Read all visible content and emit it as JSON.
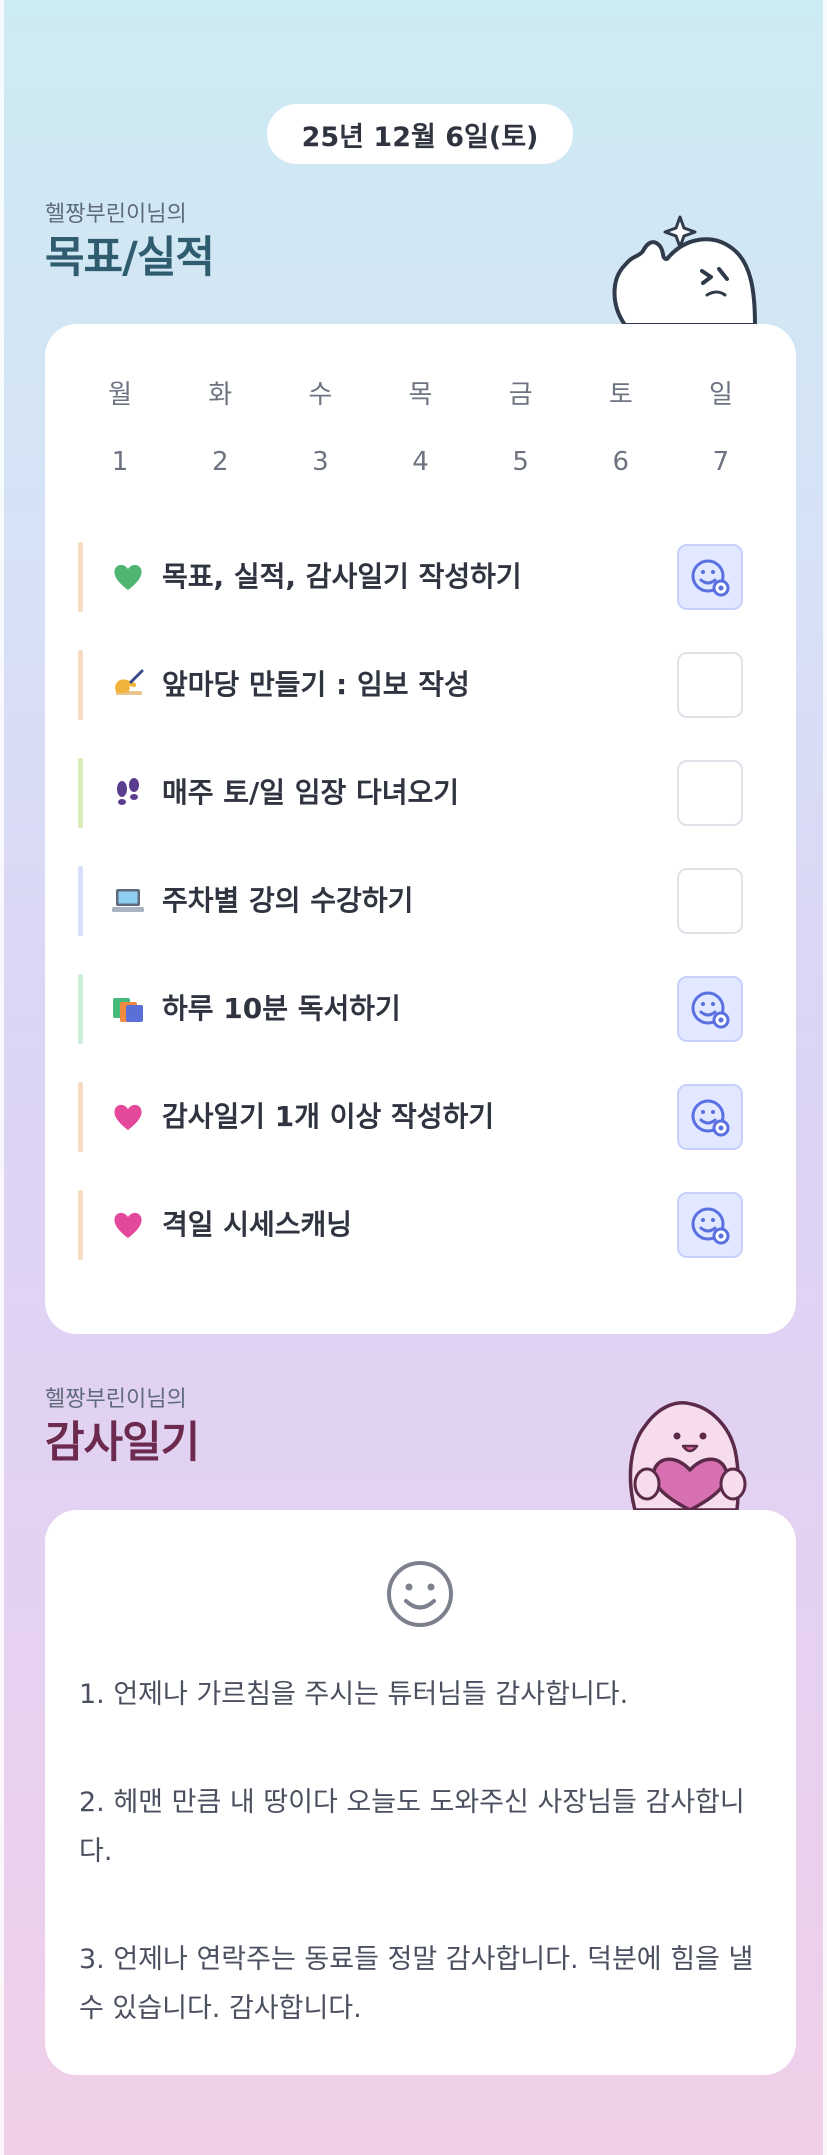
{
  "date_label": "25년 12월 6일(토)",
  "goals_section": {
    "owner_label": "헬짱부린이님의",
    "title": "목표/실적",
    "week": {
      "day_names": [
        "월",
        "화",
        "수",
        "목",
        "금",
        "토",
        "일"
      ],
      "day_numbers": [
        "1",
        "2",
        "3",
        "4",
        "5",
        "6",
        "7"
      ]
    },
    "items": [
      {
        "icon": "green-heart-icon",
        "label": "목표, 실적, 감사일기 작성하기",
        "done": true,
        "bar_color": "#f6dcc1"
      },
      {
        "icon": "writing-hand-icon",
        "label": "앞마당 만들기 : 임보 작성",
        "done": false,
        "bar_color": "#f6dcc1"
      },
      {
        "icon": "footprints-icon",
        "label": "매주 토/일 임장 다녀오기",
        "done": false,
        "bar_color": "#d8ecb7"
      },
      {
        "icon": "laptop-icon",
        "label": "주차별 강의 수강하기",
        "done": false,
        "bar_color": "#d8defb"
      },
      {
        "icon": "books-icon",
        "label": "하루 10분 독서하기",
        "done": true,
        "bar_color": "#cdeed9"
      },
      {
        "icon": "pink-heart-icon",
        "label": "감사일기 1개 이상 작성하기",
        "done": true,
        "bar_color": "#f6dcc1"
      },
      {
        "icon": "pink-heart-icon",
        "label": "격일 시세스캐닝",
        "done": true,
        "bar_color": "#f6dcc1"
      }
    ]
  },
  "thanks_section": {
    "owner_label": "헬짱부린이님의",
    "title": "감사일기",
    "entries": [
      "1. 언제나 가르침을 주시는 튜터님들 감사합니다.",
      "2. 헤맨 만큼 내 땅이다 오늘도 도와주신 사장님들 감사합니다.",
      "3. 언제나 연락주는 동료들 정말 감사합니다. 덕분에 힘을 낼 수 있습니다. 감사합니다."
    ]
  },
  "colors": {
    "goals_title": "#2f5c6e",
    "thanks_title": "#6b2a4e",
    "check_done_bg": "#e2e8ff",
    "check_done_icon": "#5a6fe0"
  }
}
